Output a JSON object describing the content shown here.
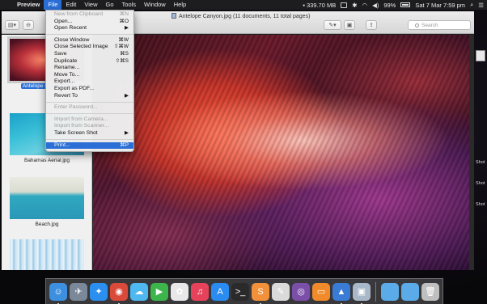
{
  "menubar": {
    "app_name": "Preview",
    "items": [
      "File",
      "Edit",
      "View",
      "Go",
      "Tools",
      "Window",
      "Help"
    ],
    "memory": "339.70 MB",
    "battery": "99%",
    "datetime": "Sat 7 Mar  7:59 pm"
  },
  "window": {
    "title": "Antelope Canyon.jpg (11 documents, 11 total pages)",
    "search_placeholder": "Search"
  },
  "sidebar": {
    "items": [
      {
        "label": "Antelope Canyon.jpg",
        "selected": true
      },
      {
        "label": "Bahamas Aerial.jpg",
        "selected": false
      },
      {
        "label": "Beach.jpg",
        "selected": false
      },
      {
        "label": "",
        "selected": false
      }
    ]
  },
  "file_menu": {
    "groups": [
      [
        {
          "label": "New from Clipboard",
          "shortcut": "⌘N",
          "disabled": true
        },
        {
          "label": "Open...",
          "shortcut": "⌘O",
          "disabled": false
        },
        {
          "label": "Open Recent",
          "shortcut": "▶",
          "disabled": false
        }
      ],
      [
        {
          "label": "Close Window",
          "shortcut": "⌘W",
          "disabled": false
        },
        {
          "label": "Close Selected Image",
          "shortcut": "⇧⌘W",
          "disabled": false
        },
        {
          "label": "Save",
          "shortcut": "⌘S",
          "disabled": false
        },
        {
          "label": "Duplicate",
          "shortcut": "⇧⌘S",
          "disabled": false
        },
        {
          "label": "Rename...",
          "shortcut": "",
          "disabled": false
        },
        {
          "label": "Move To...",
          "shortcut": "",
          "disabled": false
        },
        {
          "label": "Export...",
          "shortcut": "",
          "disabled": false
        },
        {
          "label": "Export as PDF...",
          "shortcut": "",
          "disabled": false
        },
        {
          "label": "Revert To",
          "shortcut": "▶",
          "disabled": false
        }
      ],
      [
        {
          "label": "Enter Password...",
          "shortcut": "",
          "disabled": true
        }
      ],
      [
        {
          "label": "Import from Camera...",
          "shortcut": "",
          "disabled": true
        },
        {
          "label": "Import from Scanner...",
          "shortcut": "",
          "disabled": true
        },
        {
          "label": "Take Screen Shot",
          "shortcut": "▶",
          "disabled": false
        }
      ],
      [
        {
          "label": "Print...",
          "shortcut": "⌘P",
          "disabled": false,
          "highlighted": true
        }
      ]
    ]
  },
  "desktop_labels": [
    "Shot",
    "Shot",
    "Shot"
  ],
  "dock": {
    "apps": [
      {
        "name": "finder-icon",
        "glyph": "☺",
        "color": "#3d8fe0",
        "running": true
      },
      {
        "name": "launchpad-icon",
        "glyph": "✈",
        "color": "#7a8899",
        "running": false
      },
      {
        "name": "safari-icon",
        "glyph": "✦",
        "color": "#2b8ff0",
        "running": false
      },
      {
        "name": "chrome-icon",
        "glyph": "◉",
        "color": "#d94a3a",
        "running": true
      },
      {
        "name": "messages-icon",
        "glyph": "☁",
        "color": "#4fb8f0",
        "running": false
      },
      {
        "name": "facetime-icon",
        "glyph": "▶",
        "color": "#3cb54a",
        "running": false
      },
      {
        "name": "photos-icon",
        "glyph": "✿",
        "color": "#e8e8e8",
        "running": false
      },
      {
        "name": "music-icon",
        "glyph": "♫",
        "color": "#e6425c",
        "running": false
      },
      {
        "name": "appstore-icon",
        "glyph": "A",
        "color": "#2a8cf0",
        "running": false
      },
      {
        "name": "terminal-icon",
        "glyph": ">_",
        "color": "#2a2a2a",
        "running": false
      },
      {
        "name": "sublime-icon",
        "glyph": "S",
        "color": "#f2913a",
        "running": true
      },
      {
        "name": "textedit-icon",
        "glyph": "✎",
        "color": "#dadada",
        "running": false
      },
      {
        "name": "tor-icon",
        "glyph": "◎",
        "color": "#7b4fa8",
        "running": false
      },
      {
        "name": "ibooks-icon",
        "glyph": "▭",
        "color": "#f08a2a",
        "running": false
      },
      {
        "name": "keynote-icon",
        "glyph": "▲",
        "color": "#3a7bd5",
        "running": true
      },
      {
        "name": "preview-icon",
        "glyph": "▣",
        "color": "#a9b8c8",
        "running": true
      },
      {
        "name": "folder-icon",
        "glyph": "",
        "color": "#5aabe8",
        "running": false
      },
      {
        "name": "downloads-folder-icon",
        "glyph": "",
        "color": "#5aabe8",
        "running": false
      },
      {
        "name": "trash-icon",
        "glyph": "🗑",
        "color": "#bfbfbf",
        "running": false
      }
    ]
  }
}
